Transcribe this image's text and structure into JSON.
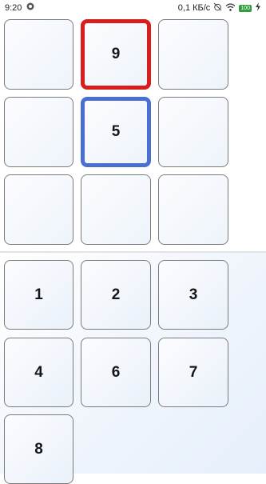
{
  "status_bar": {
    "time": "9:20",
    "network_speed": "0,1 КБ/с",
    "battery": "100"
  },
  "grid": {
    "cells": [
      {
        "value": ""
      },
      {
        "value": "9",
        "highlight": "red"
      },
      {
        "value": ""
      },
      {
        "value": ""
      },
      {
        "value": "5",
        "highlight": "blue"
      },
      {
        "value": ""
      },
      {
        "value": ""
      },
      {
        "value": ""
      },
      {
        "value": ""
      }
    ]
  },
  "picker": {
    "numbers": [
      "1",
      "2",
      "3",
      "4",
      "6",
      "7",
      "8"
    ]
  },
  "colors": {
    "red_highlight": "#d81d1d",
    "blue_highlight": "#4a6fd3",
    "tile_border": "#7b7b7b"
  }
}
